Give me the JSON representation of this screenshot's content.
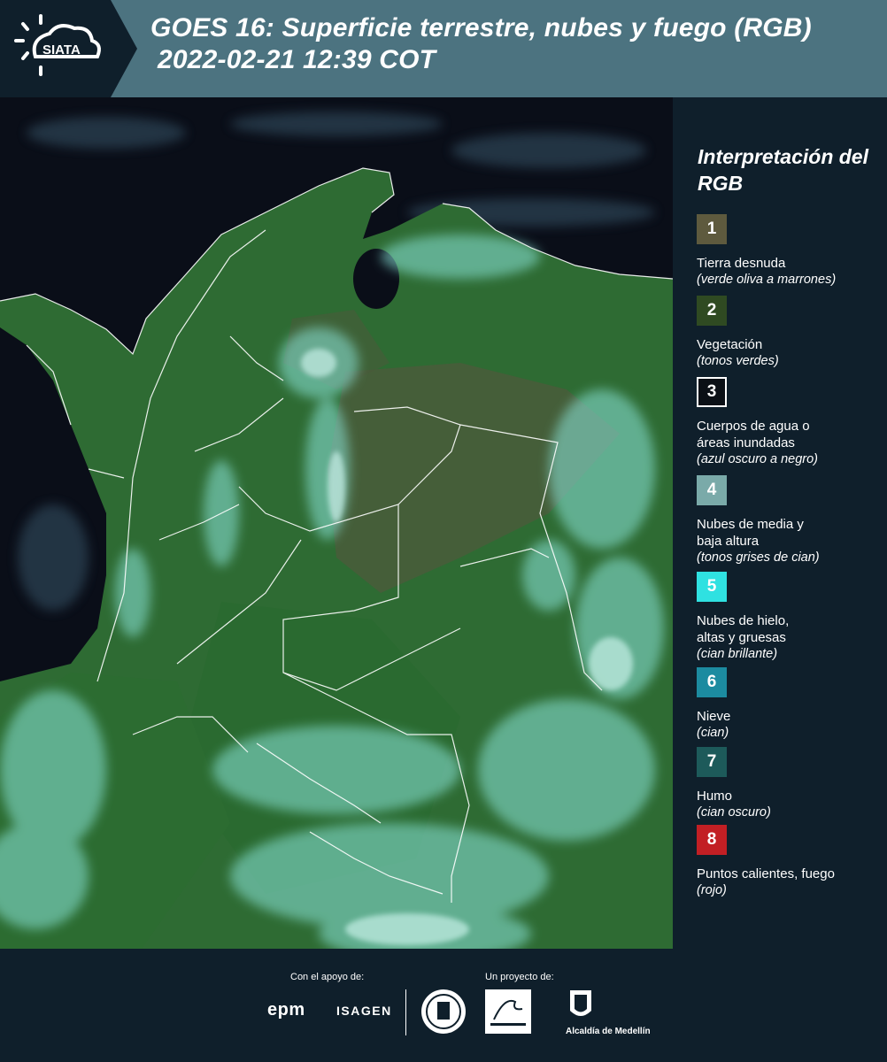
{
  "header": {
    "logo_text": "SIATA",
    "title_line1": "GOES 16: Superficie terrestre, nubes y fuego (RGB)",
    "title_line2": "2022-02-21 12:39 COT",
    "background_color": "#4c7380"
  },
  "map": {
    "description": "GOES-16 satellite RGB composite over Colombia with white departmental borders",
    "colors": {
      "ocean": "#0a0e18",
      "vegetation": "#2d6a2e",
      "bare_land": "#5a5a3c",
      "cloud": "#7fe6e0",
      "border": "#ffffff"
    }
  },
  "legend": {
    "title": "Interpretación del RGB",
    "items": [
      {
        "number": "1",
        "label": "Tierra desnuda",
        "description": "(verde oliva a marrones)",
        "color": "#5e5a3e"
      },
      {
        "number": "2",
        "label": "Vegetación",
        "description": "(tonos verdes)",
        "color": "#2f4a22"
      },
      {
        "number": "3",
        "label": "Cuerpos de agua o áreas inundadas",
        "description": "(azul oscuro a negro)",
        "color": "#0b1016"
      },
      {
        "number": "4",
        "label": "Nubes de media y baja altura",
        "description": "(tonos grises de cian)",
        "color": "#7aaaa9"
      },
      {
        "number": "5",
        "label": "Nubes de hielo, altas y gruesas",
        "description": "(cian brillante)",
        "color": "#2fe1e1"
      },
      {
        "number": "6",
        "label": "Nieve",
        "description": "(cian)",
        "color": "#1c8ba0"
      },
      {
        "number": "7",
        "label": "Humo",
        "description": "(cian oscuro)",
        "color": "#1d5a5a"
      },
      {
        "number": "8",
        "label": "Puntos calientes, fuego",
        "description": "(rojo)",
        "color": "#c21f24"
      }
    ]
  },
  "footer": {
    "support_label": "Con el apoyo de:",
    "project_label": "Un proyecto de:",
    "sponsors": [
      "epm",
      "ISAGEN"
    ],
    "partners": [
      "Área Metropolitana Valle de Aburrá",
      "Alcaldía de Medellín"
    ]
  }
}
